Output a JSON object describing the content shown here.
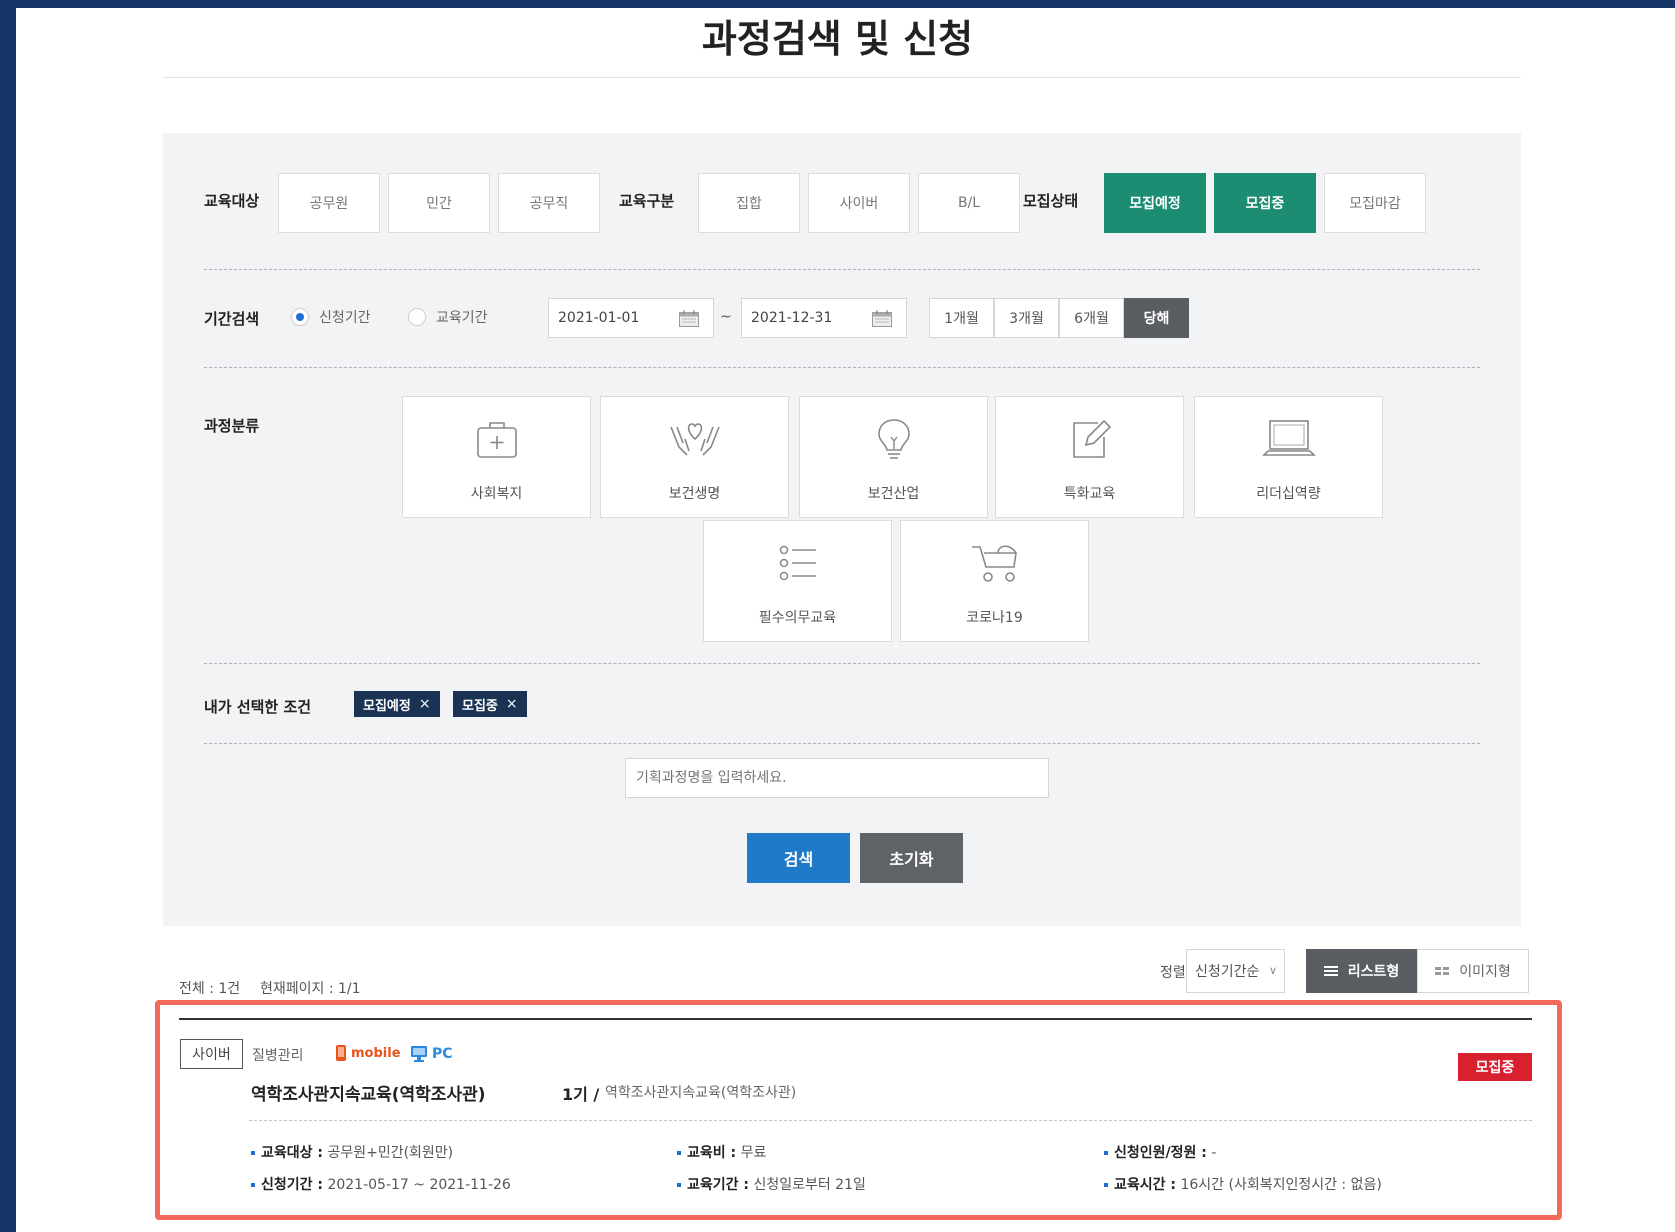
{
  "page_title": "과정검색 및 신청",
  "filters": {
    "target_label": "교육대상",
    "target_options": [
      "공무원",
      "민간",
      "공무직"
    ],
    "type_label": "교육구분",
    "type_options": [
      "집합",
      "사이버",
      "B/L"
    ],
    "status_label": "모집상태",
    "status_options": [
      "모집예정",
      "모집중",
      "모집마감"
    ],
    "status_selected": [
      "모집예정",
      "모집중"
    ]
  },
  "period": {
    "label": "기간검색",
    "radio_apply": "신청기간",
    "radio_edu": "교육기간",
    "selected": "신청기간",
    "start": "2021-01-01",
    "end": "2021-12-31",
    "separator": "~",
    "quick": [
      "1개월",
      "3개월",
      "6개월",
      "당해"
    ],
    "quick_selected": "당해"
  },
  "categories": {
    "label": "과정분류",
    "items": [
      {
        "label": "사회복지",
        "icon": "first-aid-kit-icon"
      },
      {
        "label": "보건생명",
        "icon": "heart-hands-icon"
      },
      {
        "label": "보건산업",
        "icon": "lightbulb-icon"
      },
      {
        "label": "특화교육",
        "icon": "edit-icon"
      },
      {
        "label": "리더십역량",
        "icon": "laptop-icon"
      },
      {
        "label": "필수의무교육",
        "icon": "list-icon"
      },
      {
        "label": "코로나19",
        "icon": "stroller-icon"
      }
    ]
  },
  "selected_conditions": {
    "label": "내가 선택한 조건",
    "chips": [
      "모집예정",
      "모집중"
    ],
    "remove": "×"
  },
  "search": {
    "placeholder": "기획과정명을 입력하세요.",
    "search_button": "검색",
    "reset_button": "초기화"
  },
  "results_meta": {
    "total": "전체 : 1건",
    "current_page": "현재페이지 : 1/1",
    "sort_label": "정렬 :",
    "sort_value": "신청기간순",
    "view_list": "리스트형",
    "view_image": "이미지형"
  },
  "result": {
    "tag": "사이버",
    "category": "질병관리",
    "device_mobile": "mobile",
    "device_pc": "PC",
    "title": "역학조사관지속교육(역학조사관)",
    "round": "1기 /",
    "round_name": "역학조사관지속교육(역학조사관)",
    "status": "모집중",
    "info": {
      "target_label": "교육대상 :",
      "target_value": "공무원+민간(회원만)",
      "fee_label": "교육비 :",
      "fee_value": "무료",
      "capacity_label": "신청인원/정원 :",
      "capacity_value": "-",
      "apply_label": "신청기간 :",
      "apply_value": "2021-05-17 ~ 2021-11-26",
      "period_label": "교육기간 :",
      "period_value": "신청일로부터 21일",
      "hours_label": "교육시간 :",
      "hours_value": "16시간 (사회복지인정시간 : 없음)"
    }
  },
  "colors": {
    "frame": "#153567",
    "active_green": "#1c8c72",
    "search_blue": "#1f7bc8",
    "reset_gray": "#5f6368",
    "chip_navy": "#1a3253",
    "status_red": "#d8202e",
    "highlight": "#f26a5c",
    "mobile_orange": "#e8541e",
    "pc_blue": "#2a8ae0"
  }
}
